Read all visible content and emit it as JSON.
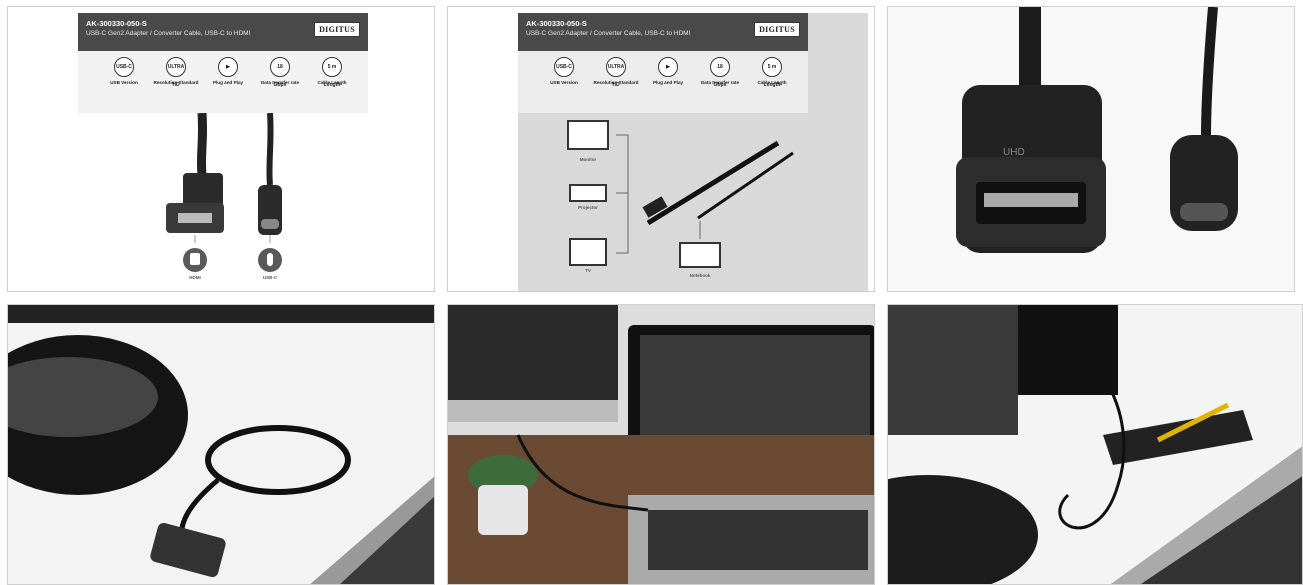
{
  "product": {
    "sku": "AK-300330-050-S",
    "description": "USB-C Gen2 Adapter / Converter Cable, USB-C to HDMI",
    "brand": "DIGITUS"
  },
  "features": [
    {
      "icon": "usb-icon",
      "badge": "USB-C",
      "label": "USB Version"
    },
    {
      "icon": "ultra-hd-icon",
      "badge": "ULTRA HD",
      "label": "Resolution Standard"
    },
    {
      "icon": "plug-and-play-icon",
      "badge": "",
      "label": "Plug and Play"
    },
    {
      "icon": "data-rate-icon",
      "badge": "18 Gbps",
      "label": "Data transfer rate"
    },
    {
      "icon": "cable-length-icon",
      "badge": "5 m Length",
      "label": "Cable Length"
    }
  ],
  "connectors": [
    "HDMI",
    "USB-C"
  ],
  "devices": [
    "Monitor",
    "Projector",
    "TV",
    "Notebook"
  ],
  "connector_marking": "UHD"
}
